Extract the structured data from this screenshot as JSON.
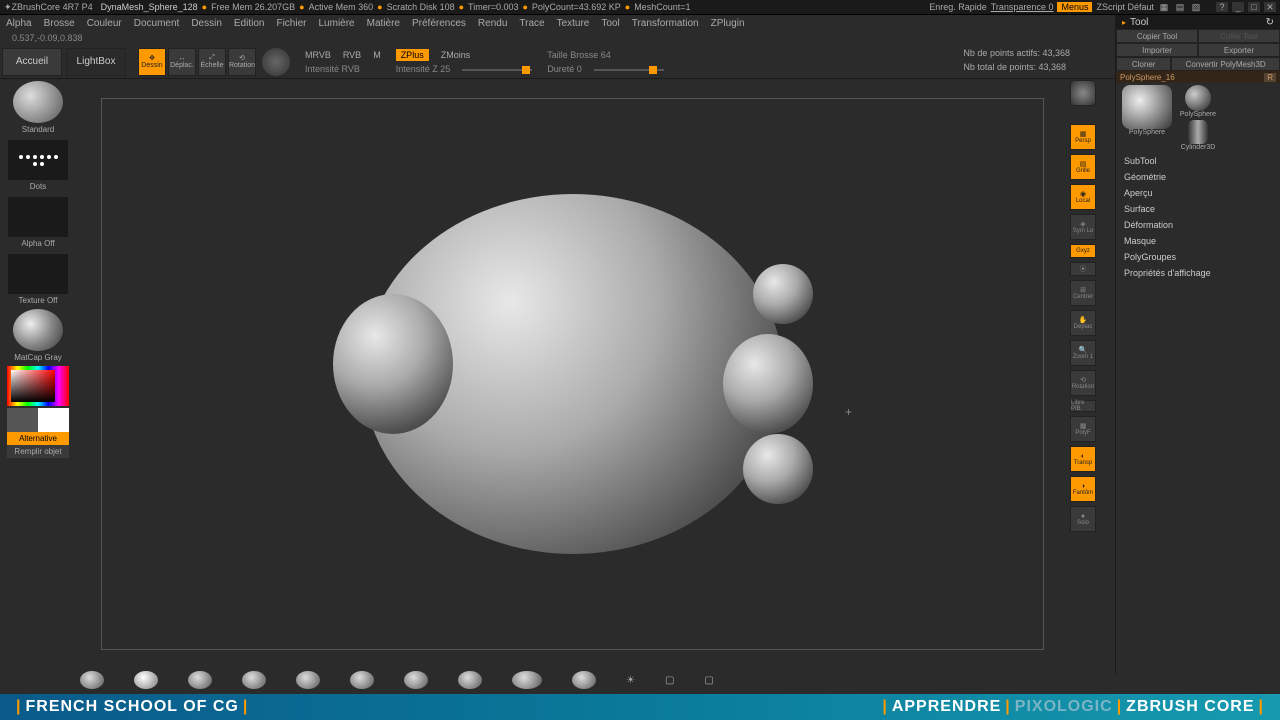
{
  "title": {
    "app": "ZBrushCore 4R7 P4",
    "doc": "DynaMesh_Sphere_128",
    "freemem": "Free Mem 26.207GB",
    "activemem": "Active Mem 360",
    "scratch": "Scratch Disk 108",
    "timer": "Timer=0.003",
    "polycount": "PolyCount=43.692 KP",
    "meshcount": "MeshCount=1",
    "save": "Enreg. Rapide",
    "transp": "Transparence 0",
    "menus": "Menus",
    "zscript": "ZScript Défaut"
  },
  "menu": [
    "Alpha",
    "Brosse",
    "Couleur",
    "Document",
    "Dessin",
    "Edition",
    "Fichier",
    "Lumière",
    "Matière",
    "Préférences",
    "Rendu",
    "Trace",
    "Texture",
    "Tool",
    "Transformation",
    "ZPlugin"
  ],
  "status": "0.537,-0.09,0.838",
  "toolbar": {
    "home": "Accueil",
    "lightbox": "LightBox",
    "modes": [
      "Dessin",
      "Déplac.",
      "Échelle",
      "Rotation"
    ],
    "row1": {
      "mrvb": "MRVB",
      "rvb": "RVB",
      "m": "M",
      "zplus": "ZPlus",
      "zmoins": "ZMoins",
      "taille": "Taille Brosse 64"
    },
    "row2": {
      "irvb": "Intensité RVB",
      "iz": "Intensité Z 25",
      "durete": "Dureté 0"
    },
    "points_active": "Nb de points actifs: 43,368",
    "points_total": "Nb total de points: 43,368"
  },
  "left": {
    "brush": "Standard",
    "dots": "Dots",
    "alpha": "Alpha Off",
    "texture": "Texture Off",
    "matcap": "MatCap Gray",
    "alt": "Alternative",
    "fill": "Remplir objet"
  },
  "right_icons": [
    "",
    "Persp",
    "Grille",
    "Local",
    "Sym Lo",
    "Gxyz",
    "",
    "Centrer",
    "Déplac",
    "Zoom 1",
    "Rotation",
    "Libre PIB",
    "PolyF",
    "Transp",
    "Fantôm",
    "Solo"
  ],
  "tool_panel": {
    "title": "Tool",
    "copy": "Copier Tool",
    "paste": "Coller Tool",
    "import": "Importer",
    "export": "Exporter",
    "clone": "Cloner",
    "convert": "Convertir PolyMesh3D",
    "name": "PolySphere_16",
    "r": "R",
    "thumbs": [
      "PolySphere",
      "PolySphere",
      "Cylinder3D"
    ],
    "sections": [
      "SubTool",
      "Géométrie",
      "Aperçu",
      "Surface",
      "Déformation",
      "Masque",
      "PolyGroupes",
      "Propriétés d'affichage"
    ]
  },
  "footer": {
    "left": "FRENCH SCHOOL OF CG",
    "r1": "APPRENDRE",
    "r2": "PIXOLOGIC",
    "r3": "ZBRUSH CORE"
  }
}
